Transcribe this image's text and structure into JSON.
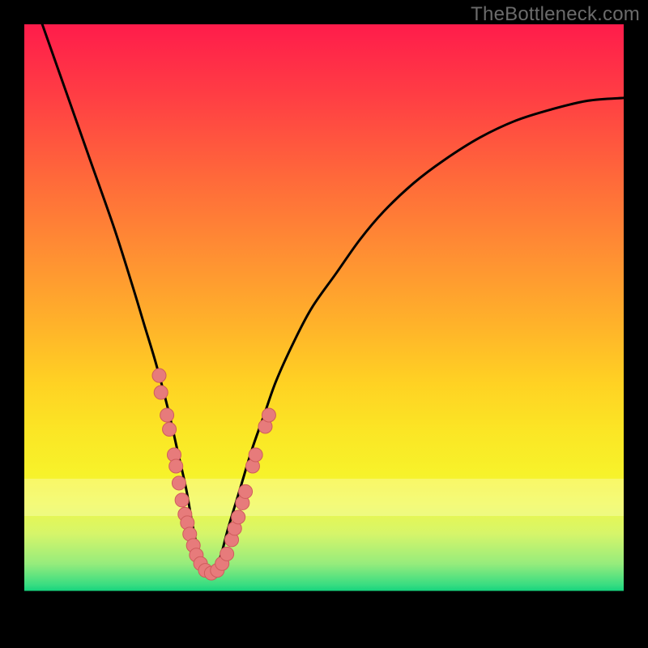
{
  "watermark": "TheBottleneck.com",
  "colors": {
    "curve": "#000000",
    "marker_fill": "#e77b7b",
    "marker_stroke": "#cf5c5c",
    "gradient_top": "#ff1c4b",
    "gradient_bottom_green": "#17d47e",
    "frame": "#000000"
  },
  "chart_data": {
    "type": "line",
    "title": "",
    "xlabel": "",
    "ylabel": "",
    "xlim": [
      0,
      100
    ],
    "ylim": [
      0,
      100
    ],
    "note": "No numeric axis labels are present; x/y units are percentages of the plot area. Curve is a V-shaped bottleneck plot with salmon marker clusters on both legs near the trough.",
    "series": [
      {
        "name": "bottleneck-curve",
        "x": [
          3,
          7,
          11,
          15,
          18,
          20,
          22,
          24,
          25.5,
          27,
          28,
          29,
          30,
          31,
          32,
          33,
          34,
          36,
          38,
          40,
          42,
          45,
          48,
          52,
          56,
          60,
          65,
          70,
          76,
          82,
          88,
          94,
          100
        ],
        "y": [
          100,
          88,
          76,
          64,
          54,
          47,
          40,
          32,
          25,
          18,
          12,
          7,
          4,
          3,
          4,
          7,
          11,
          18,
          25,
          31,
          37,
          44,
          50,
          56,
          62,
          67,
          72,
          76,
          80,
          83,
          85,
          86.5,
          87
        ]
      }
    ],
    "markers": {
      "fill": "#e77b7b",
      "stroke": "#cf5c5c",
      "radius_pct": 1.15,
      "points_xy": [
        [
          22.5,
          38
        ],
        [
          22.8,
          35
        ],
        [
          23.8,
          31
        ],
        [
          24.2,
          28.5
        ],
        [
          25.0,
          24
        ],
        [
          25.3,
          22
        ],
        [
          25.8,
          19
        ],
        [
          26.3,
          16
        ],
        [
          26.8,
          13.5
        ],
        [
          27.2,
          12
        ],
        [
          27.6,
          10
        ],
        [
          28.2,
          8
        ],
        [
          28.7,
          6.3
        ],
        [
          29.4,
          4.8
        ],
        [
          30.2,
          3.6
        ],
        [
          31.2,
          3.1
        ],
        [
          32.2,
          3.6
        ],
        [
          33.0,
          4.8
        ],
        [
          33.8,
          6.5
        ],
        [
          34.6,
          9
        ],
        [
          35.1,
          11
        ],
        [
          35.7,
          13
        ],
        [
          36.4,
          15.5
        ],
        [
          36.9,
          17.5
        ],
        [
          38.1,
          22
        ],
        [
          38.6,
          24
        ],
        [
          40.2,
          29
        ],
        [
          40.8,
          31
        ]
      ]
    }
  }
}
